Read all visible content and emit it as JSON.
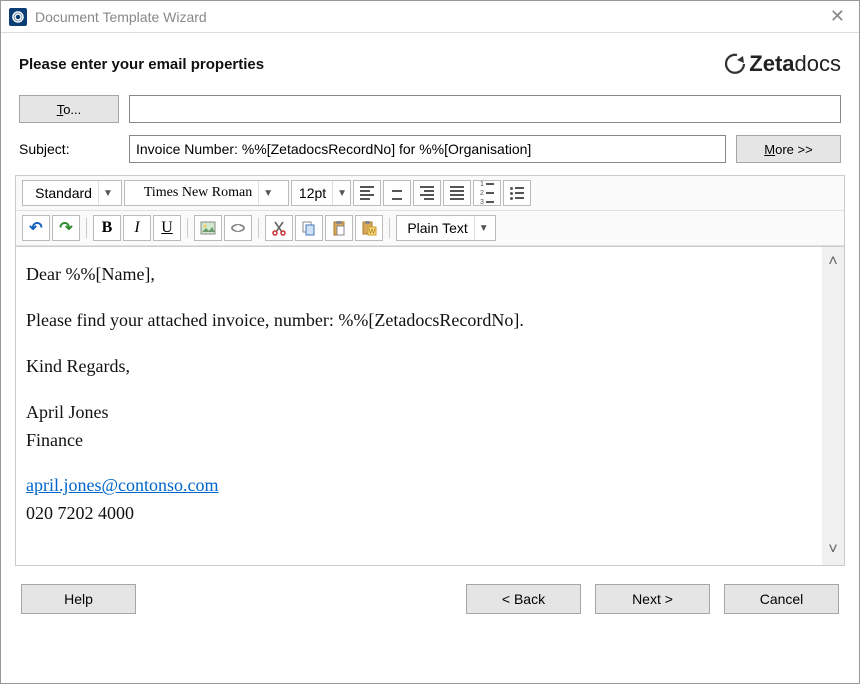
{
  "window": {
    "title": "Document Template Wizard"
  },
  "header": {
    "instruction": "Please enter your email properties",
    "brand": "Zetadocs"
  },
  "fields": {
    "to_button": "To...",
    "to_value": "",
    "subject_label": "Subject:",
    "subject_value": "Invoice Number: %%[ZetadocsRecordNo] for %%[Organisation]",
    "more_button": "More >>"
  },
  "toolbar": {
    "style_select": "Standard",
    "font_select": "Times New Roman",
    "size_select": "12pt",
    "plain_text": "Plain Text"
  },
  "body": {
    "line1": "Dear %%[Name],",
    "line2": "Please find your attached invoice, number: %%[ZetadocsRecordNo].",
    "line3": "Kind Regards,",
    "line4": "April Jones",
    "line5": "Finance",
    "email": "april.jones@contonso.com",
    "phone_partial": "020 7202 4000"
  },
  "footer": {
    "help": "Help",
    "back": "< Back",
    "next": "Next >",
    "cancel": "Cancel"
  }
}
